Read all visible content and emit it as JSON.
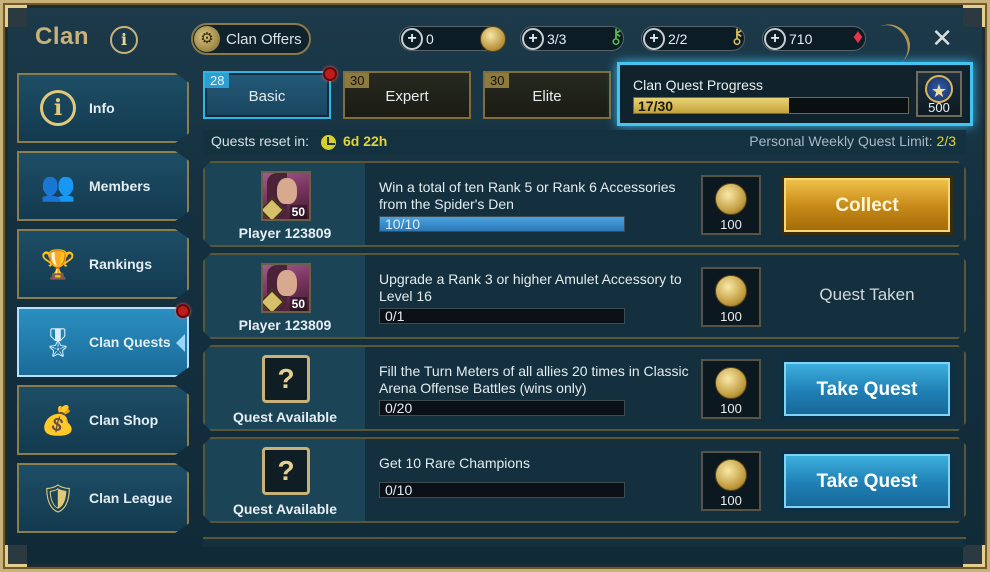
{
  "header": {
    "title": "Clan",
    "info_glyph": "i",
    "offers_label": "Clan Offers",
    "resources": [
      {
        "value": "0",
        "icon": "coin-icon"
      },
      {
        "value": "3/3",
        "icon": "green-key-icon"
      },
      {
        "value": "2/2",
        "icon": "gold-key-icon"
      },
      {
        "value": "710",
        "icon": "gem-icon"
      }
    ],
    "close_glyph": "✕"
  },
  "sidebar": {
    "items": [
      {
        "label": "Info",
        "icon": "info-icon",
        "active": false
      },
      {
        "label": "Members",
        "icon": "members-icon",
        "active": false
      },
      {
        "label": "Rankings",
        "icon": "trophy-icon",
        "active": false
      },
      {
        "label": "Clan Quests",
        "icon": "medal-icon",
        "active": true
      },
      {
        "label": "Clan Shop",
        "icon": "money-bag-icon",
        "active": false
      },
      {
        "label": "Clan League",
        "icon": "shield-icon",
        "active": false
      }
    ]
  },
  "tabs": [
    {
      "level": "28",
      "label": "Basic",
      "active": true
    },
    {
      "level": "30",
      "label": "Expert",
      "active": false
    },
    {
      "level": "30",
      "label": "Elite",
      "active": false
    }
  ],
  "clan_progress": {
    "label": "Clan Quest Progress",
    "value_text": "17/30",
    "fraction": 0.567,
    "reward_amount": "500"
  },
  "reset": {
    "label": "Quests reset in:",
    "time": "6d 22h",
    "limit_label": "Personal Weekly Quest Limit:",
    "limit_value": "2/3"
  },
  "quests": [
    {
      "owner": "Player 123809",
      "owner_level": "50",
      "has_player": true,
      "description": "Win a total of ten Rank 5 or Rank 6 Accessories from the Spider's Den",
      "progress_text": "10/10",
      "fraction": 1.0,
      "reward": "100",
      "action": "Collect",
      "action_type": "collect"
    },
    {
      "owner": "Player 123809",
      "owner_level": "50",
      "has_player": true,
      "description": "Upgrade a Rank 3 or higher Amulet Accessory to Level 16",
      "progress_text": "0/1",
      "fraction": 0.0,
      "reward": "100",
      "action": "Quest Taken",
      "action_type": "taken"
    },
    {
      "owner": "Quest Available",
      "owner_level": "",
      "has_player": false,
      "description": "Fill the Turn Meters of all allies 20 times in Classic Arena Offense Battles (wins only)",
      "progress_text": "0/20",
      "fraction": 0.0,
      "reward": "100",
      "action": "Take Quest",
      "action_type": "take"
    },
    {
      "owner": "Quest Available",
      "owner_level": "",
      "has_player": false,
      "description": "Get 10 Rare Champions",
      "progress_text": "0/10",
      "fraction": 0.0,
      "reward": "100",
      "action": "Take Quest",
      "action_type": "take"
    }
  ]
}
